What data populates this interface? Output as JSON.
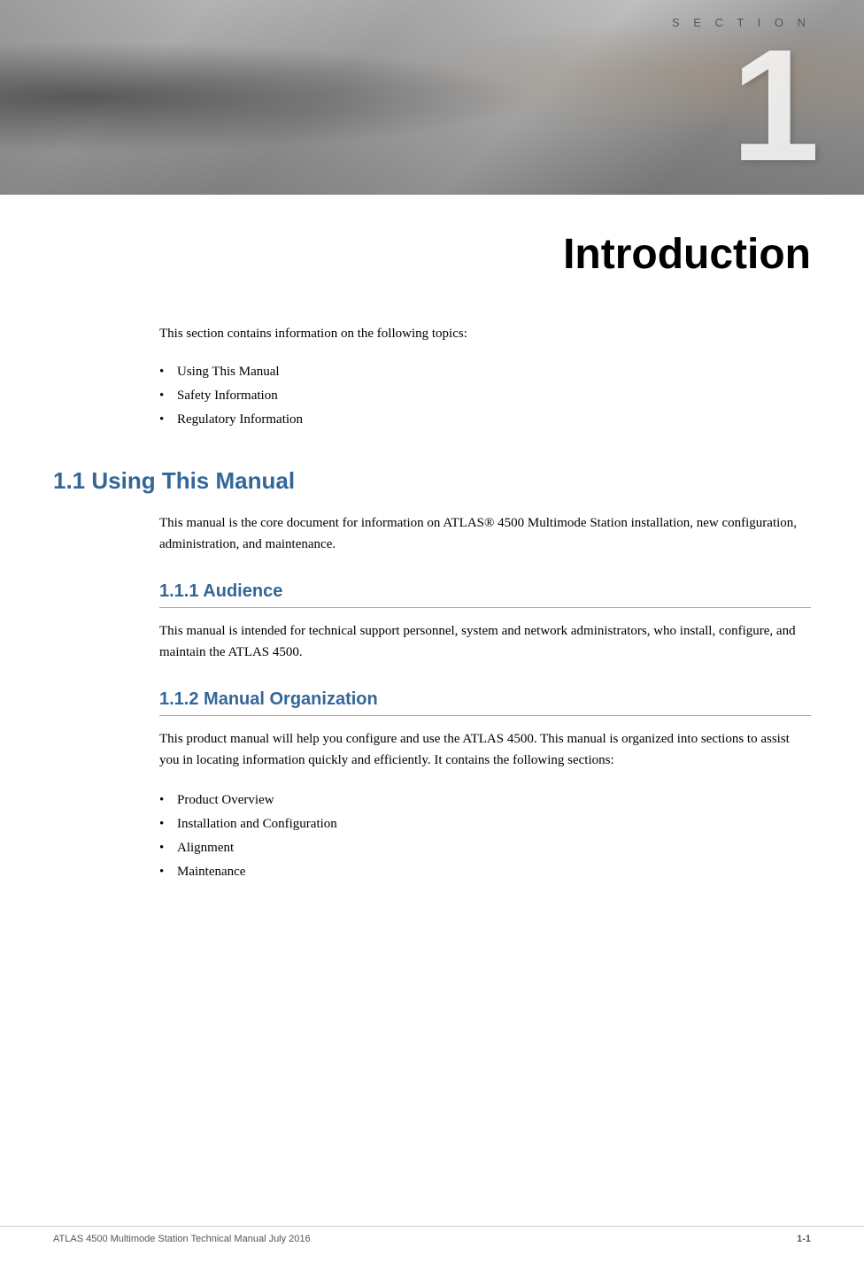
{
  "header": {
    "section_label": "S E C T I O N",
    "section_number": "1"
  },
  "chapter": {
    "title": "Introduction"
  },
  "intro": {
    "paragraph": "This section contains information on the following topics:",
    "bullets": [
      "Using This Manual",
      "Safety Information",
      "Regulatory Information"
    ]
  },
  "sections": [
    {
      "id": "1.1",
      "heading": "1.1   Using This Manual",
      "body": "This manual is the core document for information on ATLAS® 4500 Multimode Station installation, new configuration, administration, and maintenance.",
      "subsections": [
        {
          "id": "1.1.1",
          "heading": "1.1.1   Audience",
          "body": "This manual is intended for technical support personnel, system and network administrators, who install, configure, and maintain the ATLAS 4500."
        },
        {
          "id": "1.1.2",
          "heading": "1.1.2   Manual Organization",
          "body": "This product manual will help you configure and use the ATLAS 4500. This manual is organized into sections to assist you in locating information quickly and efficiently. It contains the following sections:",
          "bullets": [
            "Product Overview",
            "Installation and Configuration",
            "Alignment",
            "Maintenance"
          ]
        }
      ]
    }
  ],
  "footer": {
    "left_text": "ATLAS 4500 Multimode Station Technical Manual    July 2016",
    "page_number": "1-1"
  }
}
